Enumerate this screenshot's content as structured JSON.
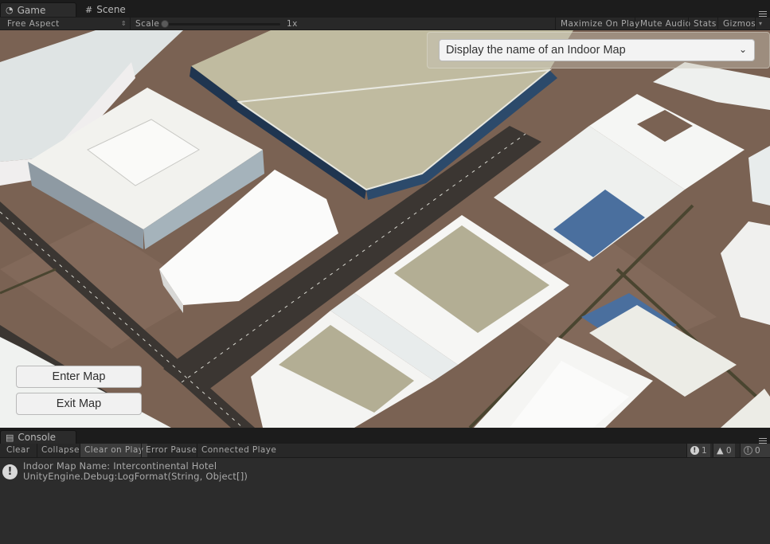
{
  "tabs": [
    {
      "label": "Game",
      "icon": "pacman-game-icon",
      "active": true
    },
    {
      "label": "Scene",
      "icon": "grid-scene-icon",
      "active": false
    }
  ],
  "game_toolbar": {
    "aspect": "Free Aspect",
    "scale_label": "Scale",
    "scale_value": "1x",
    "scale_slider_fraction": 0.0,
    "maximize_on_play": "Maximize On Play",
    "mute_audio": "Mute Audio",
    "stats": "Stats",
    "gizmos": "Gizmos"
  },
  "game_view": {
    "dropdown_text": "Display the name of an Indoor Map",
    "enter_map": "Enter Map",
    "exit_map": "Exit Map",
    "colors": {
      "ground": "#7a6253",
      "road": "#3b3632",
      "building_white": "#f4f4f0",
      "roof_beige": "#b9b49a",
      "roof_blue": "#4a6f9e",
      "facade_dark": "#1f3550"
    }
  },
  "console": {
    "tab_label": "Console",
    "toolbar": {
      "clear": "Clear",
      "collapse": "Collapse",
      "clear_on_play": "Clear on Play",
      "error_pause": "Error Pause",
      "connected_player": "Connected Playe"
    },
    "counts": {
      "info": "1",
      "warning": "0",
      "error": "0"
    },
    "entries": [
      {
        "line1": "Indoor Map Name: Intercontinental Hotel",
        "line2": "UnityEngine.Debug:LogFormat(String, Object[])",
        "type": "info"
      }
    ]
  }
}
